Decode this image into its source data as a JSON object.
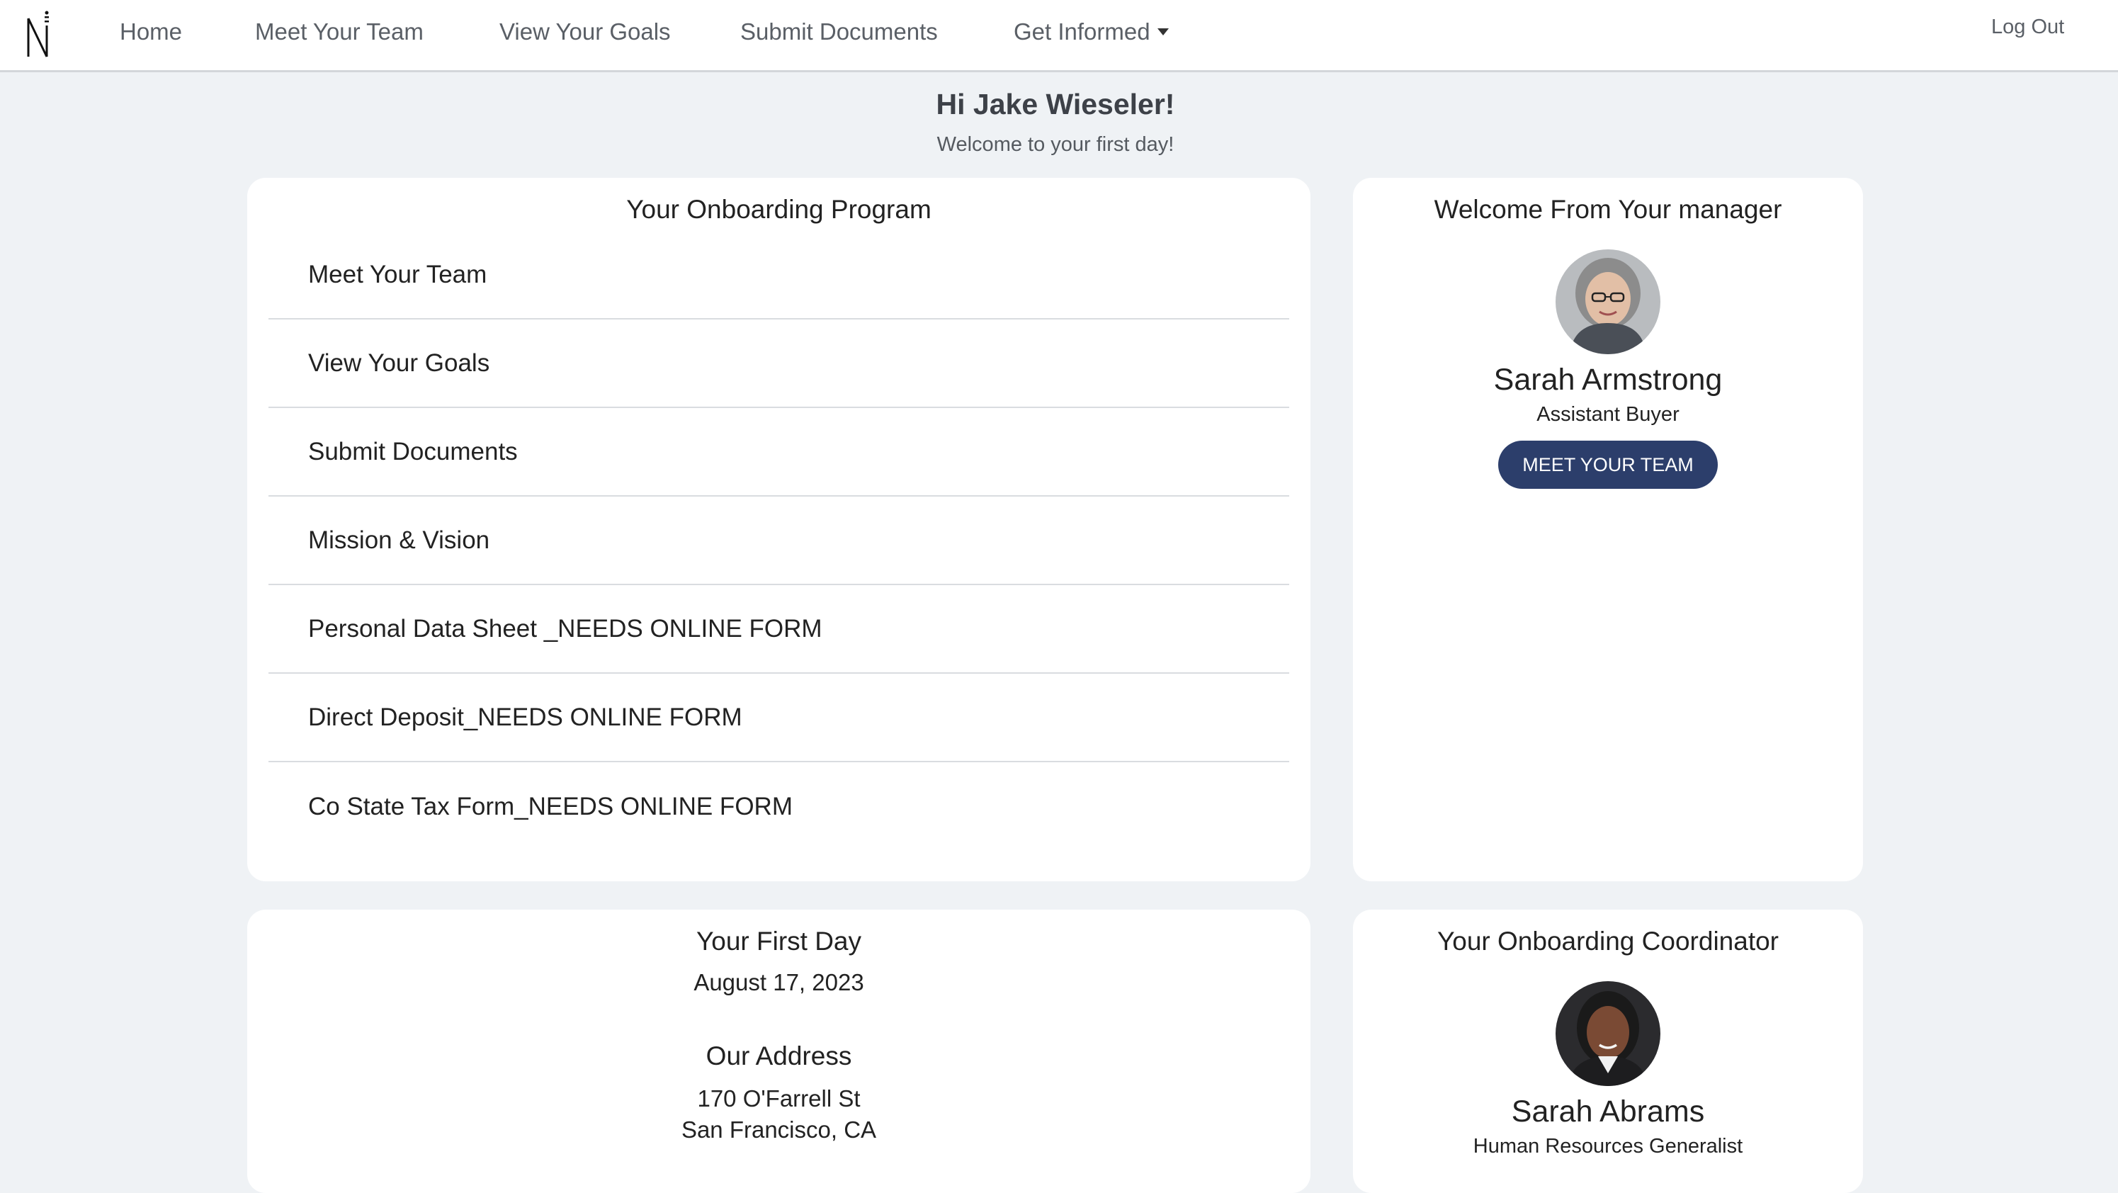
{
  "nav": {
    "logo_alt": "N",
    "home": "Home",
    "meet_team": "Meet Your Team",
    "view_goals": "View Your Goals",
    "submit_docs": "Submit Documents",
    "get_informed": "Get Informed",
    "logout": "Log Out"
  },
  "greeting": {
    "title": "Hi Jake Wieseler!",
    "subtitle": "Welcome to your first day!"
  },
  "program": {
    "title": "Your Onboarding Program",
    "items": [
      "Meet Your Team",
      "View Your Goals",
      "Submit Documents",
      "Mission & Vision",
      "Personal Data Sheet _NEEDS ONLINE FORM",
      "Direct Deposit_NEEDS ONLINE FORM",
      "Co State Tax Form_NEEDS ONLINE FORM"
    ]
  },
  "manager": {
    "title": "Welcome From Your manager",
    "name": "Sarah Armstrong",
    "role": "Assistant Buyer",
    "button": "MEET YOUR TEAM"
  },
  "first_day": {
    "title": "Your First Day",
    "date": "August 17, 2023",
    "address_title": "Our Address",
    "address_line1": "170 O'Farrell St",
    "address_line2": "San Francisco, CA"
  },
  "coordinator": {
    "title": "Your Onboarding Coordinator",
    "name": "Sarah Abrams",
    "role": "Human Resources Generalist"
  },
  "colors": {
    "accent": "#2c3e6b",
    "page_bg": "#eff2f5",
    "card_bg": "#ffffff"
  }
}
